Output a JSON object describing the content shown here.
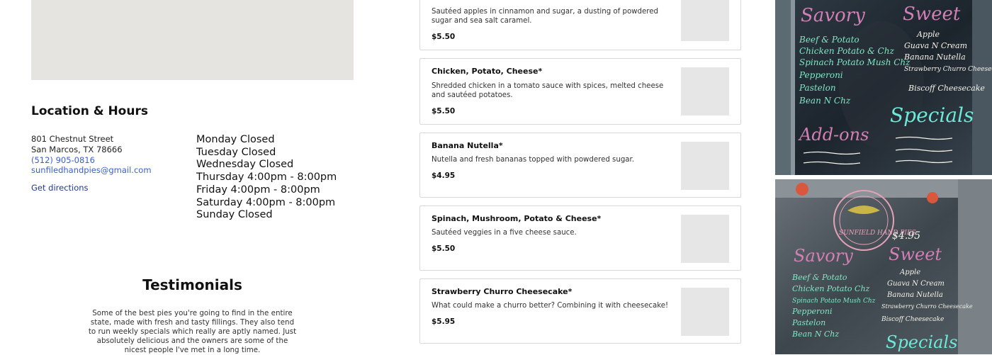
{
  "location": {
    "heading": "Location & Hours",
    "address_line1": "801 Chestnut Street",
    "address_line2": "San Marcos, TX 78666",
    "phone": "(512) 905-0816",
    "email": "sunfiledhandpies@gmail.com",
    "directions_label": "Get directions"
  },
  "hours": [
    "Monday Closed",
    "Tuesday Closed",
    "Wednesday Closed",
    "Thursday 4:00pm - 8:00pm",
    "Friday 4:00pm - 8:00pm",
    "Saturday 4:00pm - 8:00pm",
    "Sunday Closed"
  ],
  "testimonials": {
    "heading": "Testimonials",
    "quote": "Some of the best pies you're going to find in the entire state, made with fresh and tasty fillings. They also tend to run weekly specials which really are aptly named. Just absolutely delicious and the owners are some of the nicest people I've met in a long time."
  },
  "menu": [
    {
      "name": "",
      "description": "Sautéed apples in cinnamon and sugar, a dusting of powdered sugar and sea salt caramel.",
      "price": "$5.50"
    },
    {
      "name": "Chicken, Potato, Cheese*",
      "description": "Shredded chicken in a tomato sauce with spices, melted cheese and sautéed potatoes.",
      "price": "$5.50"
    },
    {
      "name": "Banana Nutella*",
      "description": "Nutella and fresh bananas topped with powdered sugar.",
      "price": "$4.95"
    },
    {
      "name": "Spinach, Mushroom, Potato & Cheese*",
      "description": "Sautéed veggies in a five cheese sauce.",
      "price": "$5.50"
    },
    {
      "name": "Strawberry Churro Cheesecake*",
      "description": "What could make a churro better? Combining it with cheesecake!",
      "price": "$5.95"
    }
  ],
  "photos": {
    "top": {
      "savory_heading": "Savory",
      "sweet_heading": "Sweet",
      "savory_items": [
        "Beef & Potato",
        "Chicken Potato & Chz",
        "Spinach Potato Mush Chz",
        "Pepperoni",
        "Pastelon",
        "Bean N Chz"
      ],
      "sweet_items": [
        "Apple",
        "Guava N Cream",
        "Banana Nutella",
        "Strawberry Churro Cheesecake",
        "Biscoff Cheesecake"
      ],
      "specials_heading": "Specials",
      "addons_heading": "Add-ons"
    },
    "bottom": {
      "logo_text": "SUNFIELD HAND PIES",
      "price_text": "$4.95",
      "savory_heading": "Savory",
      "sweet_heading": "Sweet",
      "savory_items": [
        "Beef & Potato",
        "Chicken Potato Chz",
        "Spinach Potato Mush Chz",
        "Pepperoni",
        "Pastelon",
        "Bean N Chz"
      ],
      "sweet_items": [
        "Apple",
        "Guava N Cream",
        "Banana Nutella",
        "Strawberry Churro Cheesecake",
        "Biscoff Cheesecake"
      ],
      "specials_heading": "Specials"
    }
  }
}
